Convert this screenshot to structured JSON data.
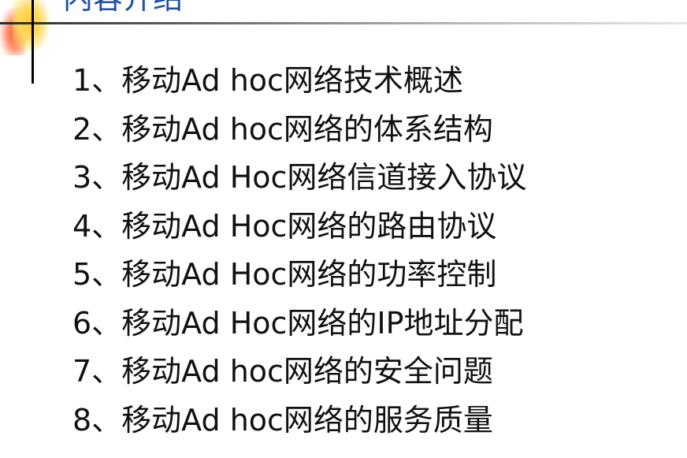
{
  "slide": {
    "title": "内容介绍",
    "items": [
      "1、移动Ad hoc网络技术概述",
      "2、移动Ad hoc网络的体系结构",
      "3、移动Ad Hoc网络信道接入协议",
      "4、移动Ad Hoc网络的路由协议",
      "5、移动Ad Hoc网络的功率控制",
      "6、移动Ad Hoc网络的IP地址分配",
      "7、移动Ad hoc网络的安全问题",
      "8、移动Ad hoc网络的服务质量"
    ]
  },
  "colors": {
    "title": "#1f4fa8",
    "text": "#111111",
    "accent_red": "#ff5a3c",
    "accent_yellow": "#ffcc33"
  }
}
